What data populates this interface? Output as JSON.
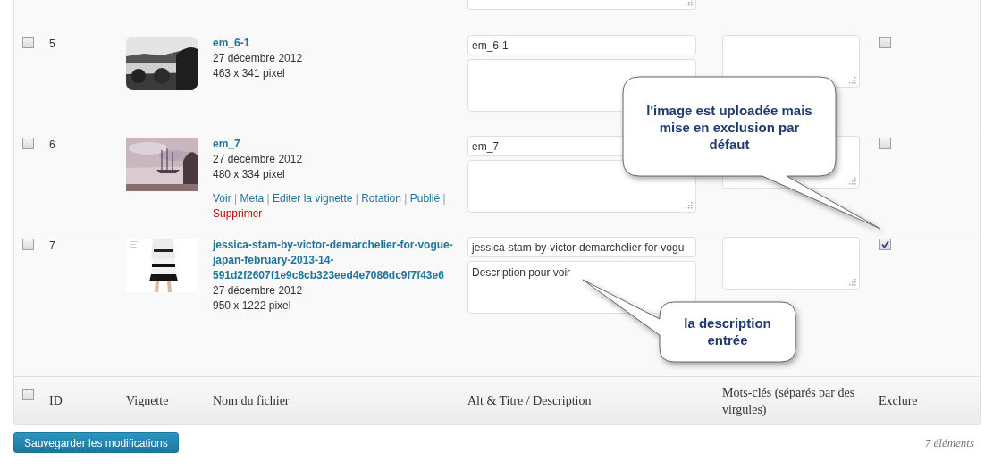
{
  "rows": [
    {
      "id": "5",
      "selected": false,
      "thumbnail": {
        "kind": "lake"
      },
      "name": "em_6-1",
      "date": "27 décembre 2012",
      "size": "463 x 341 pixel",
      "alt": "em_6-1",
      "exclude": false
    },
    {
      "id": "6",
      "selected": false,
      "thumbnail": {
        "kind": "harbor"
      },
      "name": "em_7",
      "date": "27 décembre 2012",
      "size": "480 x 334 pixel",
      "alt": "em_7",
      "exclude": false,
      "action_separator": "|",
      "actions": [
        {
          "label": "Voir",
          "kind": "link"
        },
        {
          "label": "Meta",
          "kind": "link"
        },
        {
          "label": "Editer la vignette",
          "kind": "link"
        },
        {
          "label": "Rotation",
          "kind": "link"
        },
        {
          "label": "Publié",
          "kind": "link"
        },
        {
          "label": "Supprimer",
          "kind": "delete"
        }
      ]
    },
    {
      "id": "7",
      "selected": false,
      "thumbnail": {
        "kind": "fashion"
      },
      "name": "jessica-stam-by-victor-demarchelier-for-vogue-japan-february-2013-14-591d2f2607f1e9c8cb323eed4e7086dc9f7f43e6",
      "date": "27 décembre 2012",
      "size": "950 x 1222 pixel",
      "alt": "jessica-stam-by-victor-demarchelier-for-vogu",
      "description": "Description pour voir",
      "exclude": true
    }
  ],
  "footer": {
    "select_all": false,
    "columns": [
      "ID",
      "Vignette",
      "Nom du fichier",
      "Alt & Titre / Description",
      "Mots-clés (séparés par des virgules)",
      "Exclure"
    ]
  },
  "save_button": "Sauvegarder les modifications",
  "count": "7 éléments",
  "callouts": [
    {
      "text": "l'image est uploadée mais mise en exclusion par défaut"
    },
    {
      "text": "la description entrée"
    }
  ]
}
